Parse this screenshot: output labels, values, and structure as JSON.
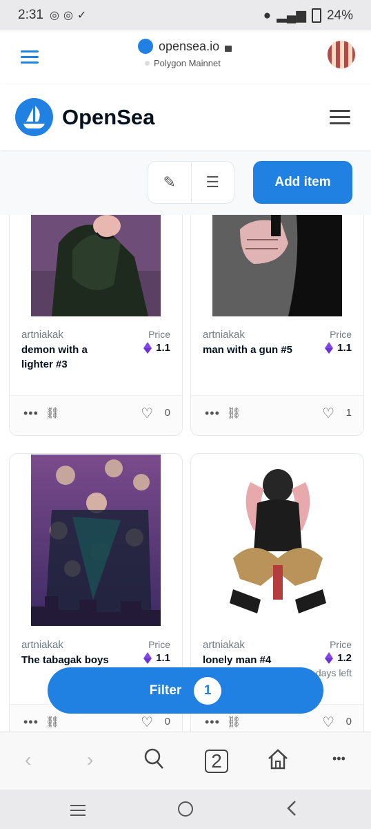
{
  "status": {
    "time": "2:31",
    "battery": "24%"
  },
  "browser": {
    "url": "opensea.io",
    "network": "Polygon Mainnet",
    "tab_count": "2"
  },
  "header": {
    "brand": "OpenSea"
  },
  "toolbar": {
    "add_label": "Add item"
  },
  "cards": [
    {
      "creator": "artniakak",
      "name": "demon with a lighter #3",
      "price_label": "Price",
      "price": "1.1",
      "likes": "0"
    },
    {
      "creator": "artniakak",
      "name": "man with a gun #5",
      "price_label": "Price",
      "price": "1.1",
      "likes": "1"
    },
    {
      "creator": "artniakak",
      "name": "The tabagak boys",
      "price_label": "Price",
      "price": "1.1",
      "likes": "0"
    },
    {
      "creator": "artniakak",
      "name": "lonely man #4",
      "price_label": "Price",
      "price": "1.2",
      "likes": "0",
      "extra": "days left"
    }
  ],
  "filter": {
    "label": "Filter",
    "count": "1"
  },
  "icons": {
    "menu": "hamburger-icon",
    "lock": "lock-icon",
    "edit": "pencil-icon",
    "list": "list-icon",
    "more": "more-horizontal-icon",
    "link": "link-icon",
    "heart": "heart-icon",
    "back": "chevron-left-icon",
    "forward": "chevron-right-icon",
    "search": "search-icon",
    "home": "home-icon"
  },
  "colors": {
    "accent": "#2081e2",
    "eth": "#8247e5"
  }
}
